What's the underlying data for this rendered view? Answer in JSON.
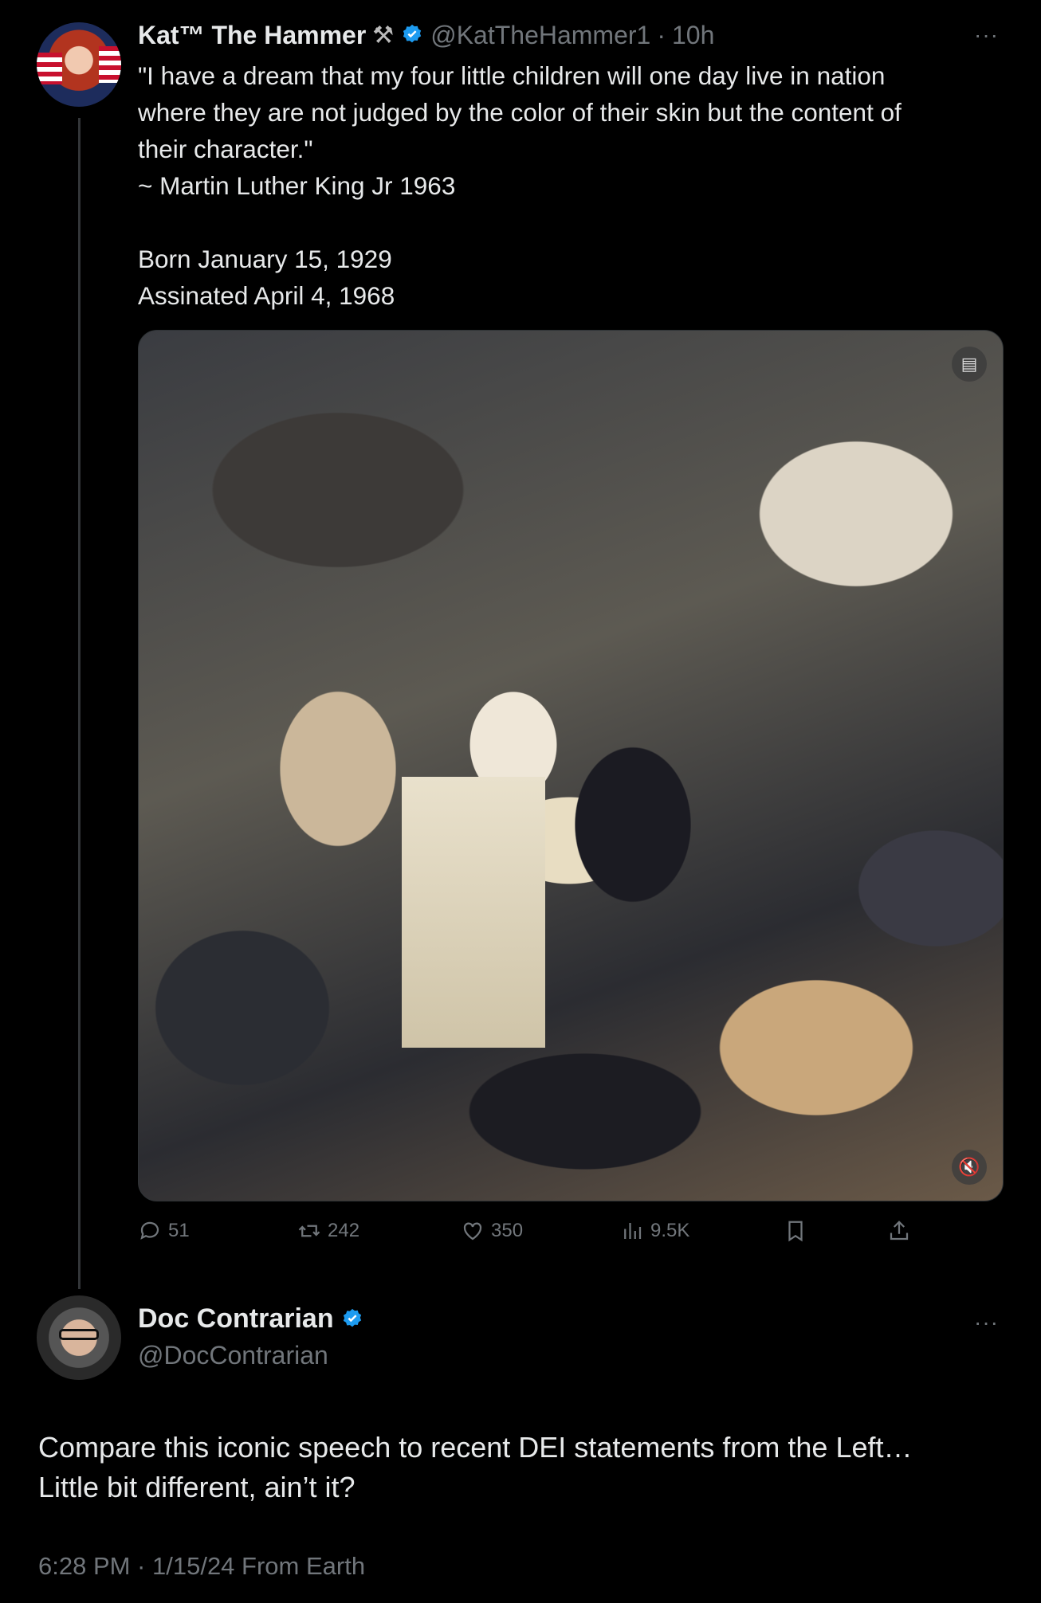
{
  "tweet": {
    "author_name": "Kat™ The Hammer",
    "author_emoji": "⚒",
    "handle": "@KatTheHammer1",
    "separator": "·",
    "time": "10h",
    "more": "···",
    "text": "\"I have a dream that my four little children will one day live in nation\nwhere they are not judged by the color of their skin but the content of\ntheir character.\"\n~ Martin Luther King Jr  1963\n\nBorn January 15, 1929\nAssinated April 4, 1968",
    "media_icons": [
      "captions-icon",
      "mute-icon"
    ],
    "actions": {
      "replies": "51",
      "reposts": "242",
      "likes": "350",
      "views": "9.5K"
    }
  },
  "reply": {
    "author_name": "Doc Contrarian",
    "handle": "@DocContrarian",
    "more": "···",
    "text": "Compare this iconic speech to recent DEI statements from the Left…\nLittle bit different, ain’t it?",
    "footer": "6:28 PM · 1/15/24 From Earth"
  },
  "colors": {
    "background": "#000000",
    "text": "#e7e9ea",
    "muted": "#71767b",
    "verified": "#1d9bf0"
  }
}
